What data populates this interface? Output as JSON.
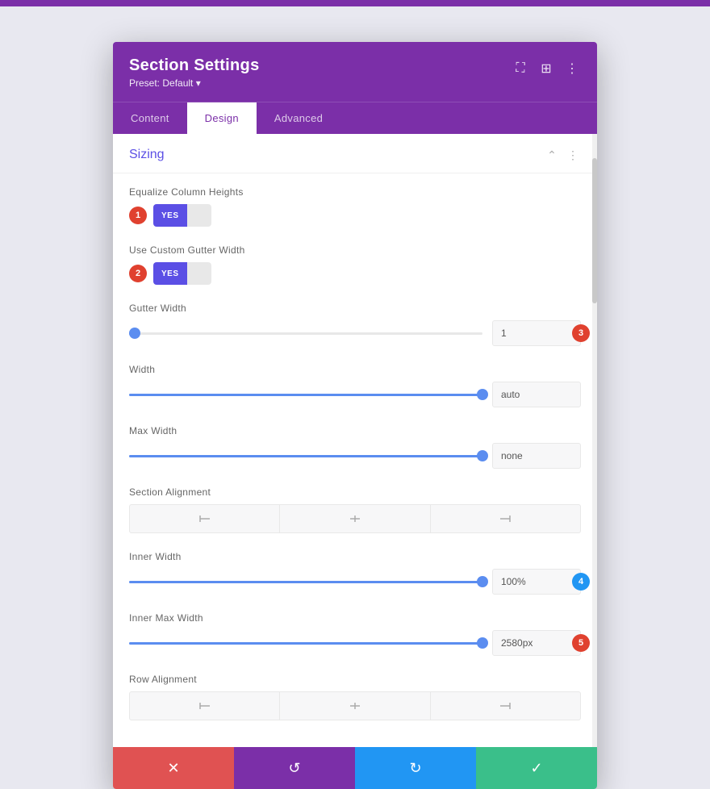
{
  "topBar": {},
  "modal": {
    "title": "Section Settings",
    "preset_label": "Preset: Default",
    "preset_arrow": "▾",
    "icons": {
      "expand": "⛶",
      "layout": "⊞",
      "more": "⋮"
    },
    "tabs": [
      {
        "id": "content",
        "label": "Content",
        "active": false
      },
      {
        "id": "design",
        "label": "Design",
        "active": true
      },
      {
        "id": "advanced",
        "label": "Advanced",
        "active": false
      }
    ],
    "section": {
      "title": "Sizing",
      "collapse_icon": "⌃",
      "more_icon": "⋮"
    },
    "settings": {
      "equalize_columns": {
        "label": "Equalize Column Heights",
        "badge": "1",
        "badge_color": "red",
        "yes_label": "YES"
      },
      "custom_gutter": {
        "label": "Use Custom Gutter Width",
        "badge": "2",
        "badge_color": "red",
        "yes_label": "YES"
      },
      "gutter_width": {
        "label": "Gutter Width",
        "slider_pct": 2,
        "value": "1",
        "badge": "3",
        "badge_color": "red"
      },
      "width": {
        "label": "Width",
        "slider_pct": 100,
        "value": "auto"
      },
      "max_width": {
        "label": "Max Width",
        "slider_pct": 100,
        "value": "none"
      },
      "section_alignment": {
        "label": "Section Alignment",
        "options": [
          "left",
          "center",
          "right"
        ]
      },
      "inner_width": {
        "label": "Inner Width",
        "slider_pct": 100,
        "value": "100%",
        "badge": "4",
        "badge_color": "blue"
      },
      "inner_max_width": {
        "label": "Inner Max Width",
        "slider_pct": 100,
        "value": "2580px",
        "badge": "5",
        "badge_color": "red"
      },
      "row_alignment": {
        "label": "Row Alignment",
        "options": [
          "left",
          "center",
          "right"
        ]
      }
    },
    "footer": {
      "cancel_icon": "✕",
      "undo_icon": "↺",
      "redo_icon": "↻",
      "save_icon": "✓"
    }
  }
}
